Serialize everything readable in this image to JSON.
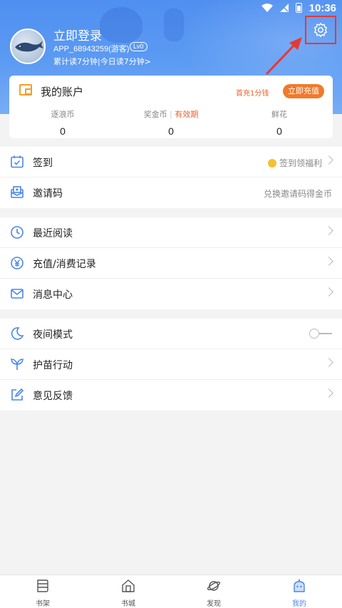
{
  "status_bar": {
    "time": "10:36"
  },
  "profile": {
    "login_title": "立即登录",
    "user_id": "APP_68943259(游客)",
    "level": "Lv0",
    "read_stats": "累计读7分钟|今日读7分钟>"
  },
  "account": {
    "title": "我的账户",
    "first_recharge": "首充1分钱",
    "recharge_button": "立即充值",
    "stats": [
      {
        "label": "逐浪币",
        "value": "0"
      },
      {
        "label": "奖金币",
        "valid_label": "有效期",
        "value": "0"
      },
      {
        "label": "鲜花",
        "value": "0"
      }
    ]
  },
  "menu_group_1": [
    {
      "label": "签到",
      "right_text": "签到领福利"
    },
    {
      "label": "邀请码",
      "right_text": "兑换邀请码得金币"
    }
  ],
  "menu_group_2": [
    {
      "label": "最近阅读"
    },
    {
      "label": "充值/消费记录"
    },
    {
      "label": "消息中心"
    }
  ],
  "menu_group_3": [
    {
      "label": "夜间模式",
      "toggle_on": false
    },
    {
      "label": "护苗行动"
    },
    {
      "label": "意见反馈"
    }
  ],
  "bottom_nav": [
    {
      "label": "书架",
      "icon": "bookshelf-icon"
    },
    {
      "label": "书城",
      "icon": "bookstore-icon"
    },
    {
      "label": "发现",
      "icon": "discover-icon"
    },
    {
      "label": "我的",
      "icon": "mine-icon",
      "active": true
    }
  ],
  "colors": {
    "header_blue": "#5c9bf3",
    "accent_orange": "#f07a2c",
    "menu_icon_blue": "#4a86e8",
    "highlight_red": "#e53935"
  }
}
